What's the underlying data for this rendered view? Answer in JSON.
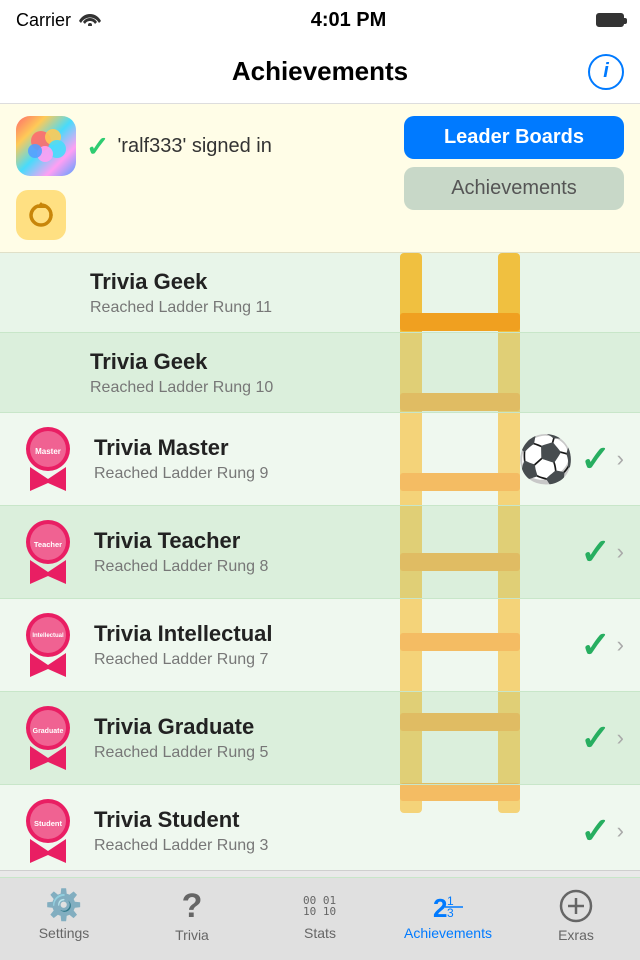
{
  "statusBar": {
    "carrier": "Carrier",
    "time": "4:01 PM"
  },
  "navBar": {
    "title": "Achievements",
    "infoButton": "i"
  },
  "gameCenterBanner": {
    "signedInText": "'ralf333'  signed in",
    "leaderBoardsLabel": "Leader Boards",
    "achievementsLabel": "Achievements"
  },
  "achievements": [
    {
      "name": "Trivia Geek",
      "sub": "Reached Ladder Rung 11",
      "hasIcon": false,
      "completed": false,
      "ribbonColor": null
    },
    {
      "name": "Trivia Geek",
      "sub": "Reached Ladder Rung 10",
      "hasIcon": false,
      "completed": false,
      "ribbonColor": null
    },
    {
      "name": "Trivia Master",
      "sub": "Reached Ladder Rung 9",
      "hasIcon": true,
      "completed": true,
      "ribbonColor": "#e91e63",
      "ribbonLabel": "Master",
      "hasBall": true
    },
    {
      "name": "Trivia Teacher",
      "sub": "Reached Ladder Rung 8",
      "hasIcon": true,
      "completed": true,
      "ribbonColor": "#e91e63",
      "ribbonLabel": "Teacher"
    },
    {
      "name": "Trivia Intellectual",
      "sub": "Reached Ladder Rung 7",
      "hasIcon": true,
      "completed": true,
      "ribbonColor": "#e91e63",
      "ribbonLabel": "Intellectual"
    },
    {
      "name": "Trivia Graduate",
      "sub": "Reached Ladder Rung 5",
      "hasIcon": true,
      "completed": true,
      "ribbonColor": "#e91e63",
      "ribbonLabel": "Graduate"
    },
    {
      "name": "Trivia Student",
      "sub": "Reached Ladder Rung 3",
      "hasIcon": true,
      "completed": true,
      "ribbonColor": "#e91e63",
      "ribbonLabel": "Student"
    }
  ],
  "tabBar": {
    "items": [
      {
        "label": "Settings",
        "icon": "⚙"
      },
      {
        "label": "Trivia",
        "icon": "?"
      },
      {
        "label": "Stats",
        "icon": "stats"
      },
      {
        "label": "Achievements",
        "icon": "score",
        "active": true
      },
      {
        "label": "Exras",
        "icon": "+"
      }
    ]
  }
}
